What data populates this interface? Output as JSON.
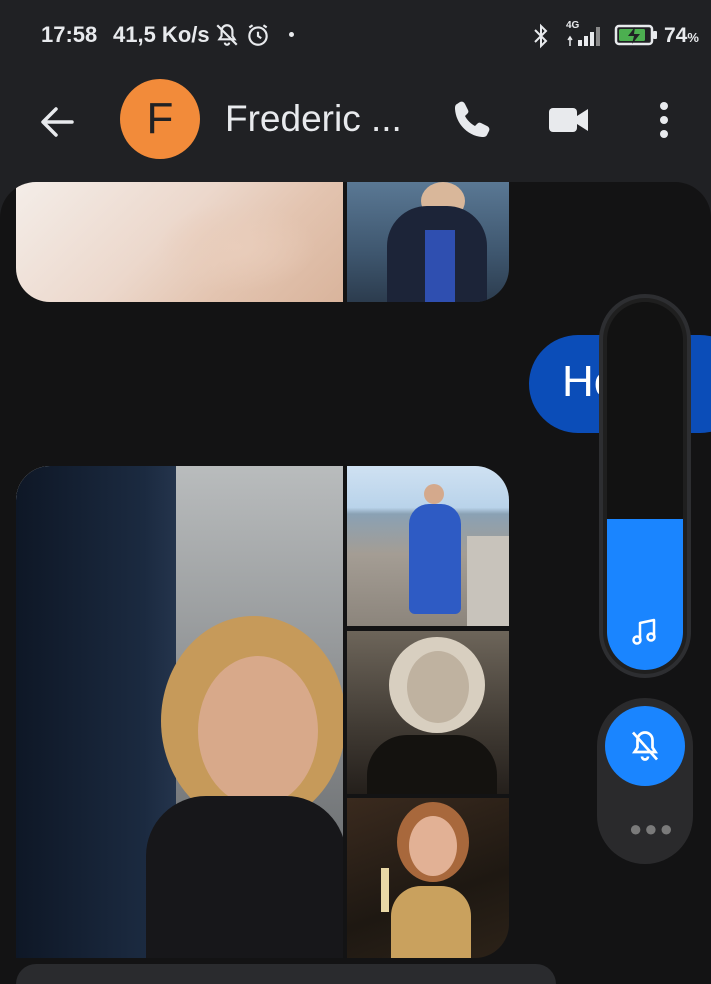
{
  "status_bar": {
    "time": "17:58",
    "speed": "41,5 Ko/s",
    "network": "4G",
    "battery": "74",
    "battery_unit": "%"
  },
  "conversation": {
    "avatar_letter": "F",
    "contact_name": "Frederic ..."
  },
  "messages": {
    "outgoing_text": "Hey"
  },
  "volume": {
    "level": 0.41,
    "accent": "#1a85ff"
  },
  "colors": {
    "avatar_bg": "#f28b3a",
    "outgoing_bubble": "#0b4db8"
  },
  "icons": [
    "back-arrow-icon",
    "phone-icon",
    "video-call-icon",
    "more-vert-icon",
    "music-note-icon",
    "bell-off-icon"
  ]
}
